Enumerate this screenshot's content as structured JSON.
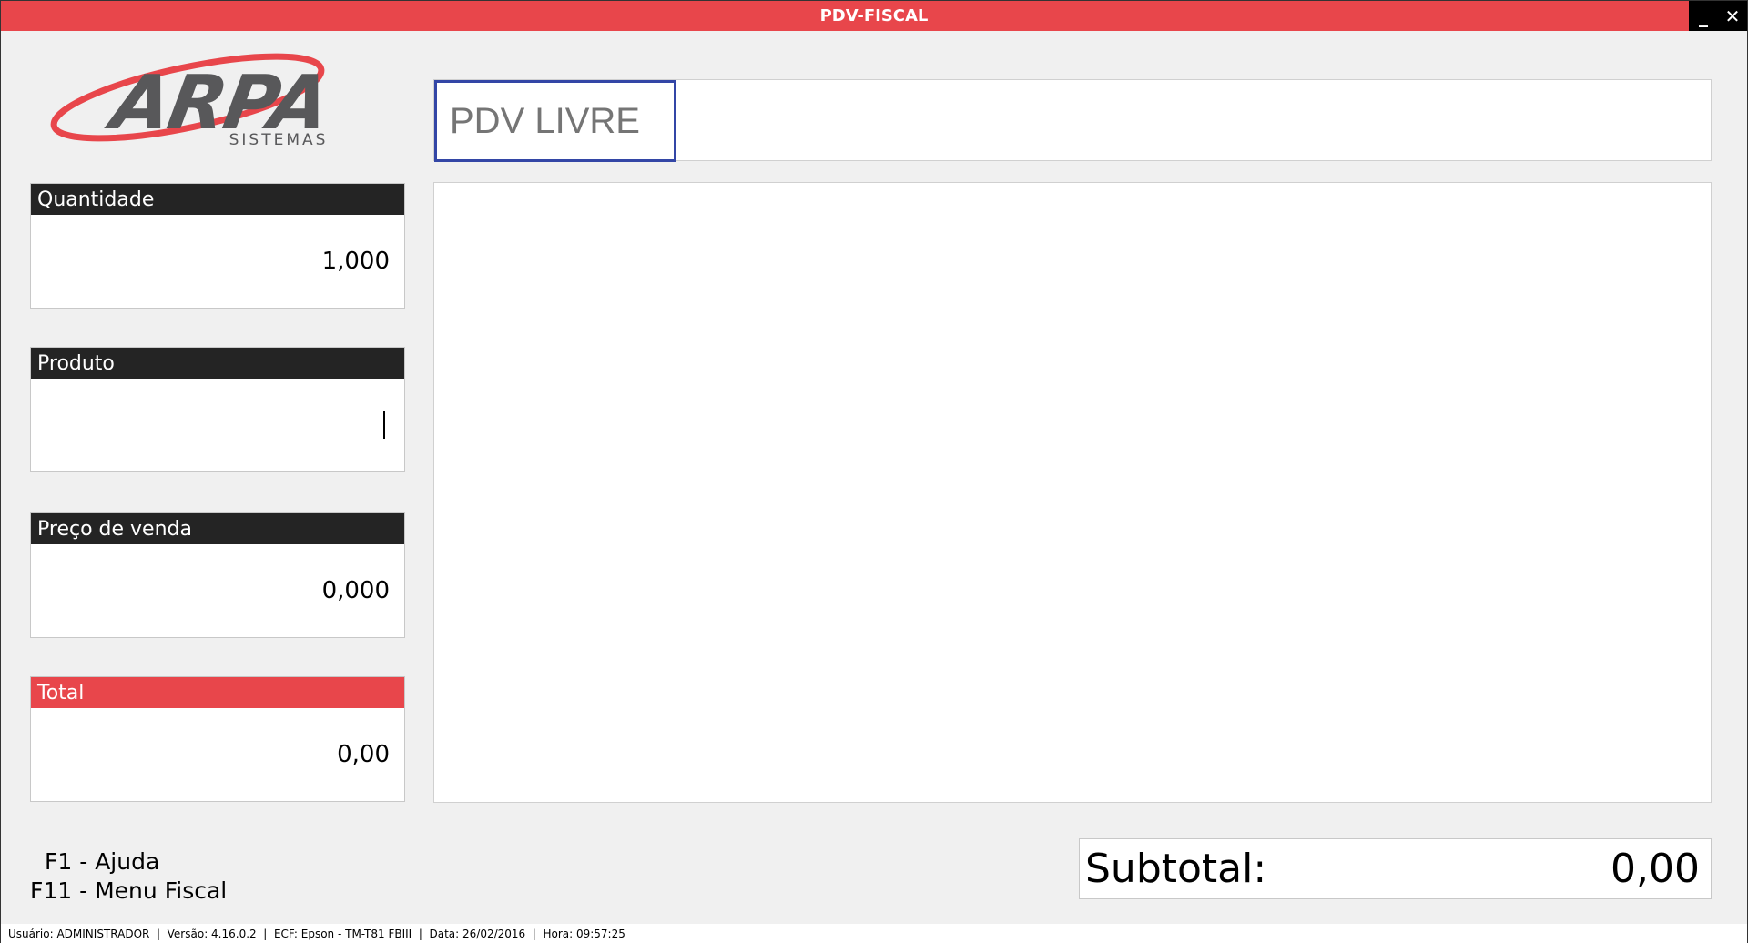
{
  "window": {
    "title": "PDV-FISCAL",
    "minimize_glyph": "_",
    "close_glyph": "✕"
  },
  "logo": {
    "brand": "ARPA",
    "subtitle": "SISTEMAS",
    "colors": {
      "text": "#58585a",
      "swoosh": "#e8464b"
    }
  },
  "status": {
    "text": "PDV LIVRE"
  },
  "fields": {
    "quantidade": {
      "label": "Quantidade",
      "value": "1,000"
    },
    "produto": {
      "label": "Produto",
      "value": ""
    },
    "preco": {
      "label": "Preço de venda",
      "value": "0,000"
    },
    "total": {
      "label": "Total",
      "value": "0,00"
    }
  },
  "help": {
    "f1": "F1 - Ajuda",
    "f11": "F11 - Menu Fiscal"
  },
  "subtotal": {
    "label": "Subtotal:",
    "value": "0,00"
  },
  "statusbar": {
    "text": "Usuário: ADMINISTRADOR  |  Versão: 4.16.0.2  |  ECF: Epson - TM-T81 FBIII  |  Data: 26/02/2016  |  Hora: 09:57:25"
  },
  "colors": {
    "accent": "#e8464b",
    "label_bg": "#242424",
    "status_border": "#3346a6"
  }
}
